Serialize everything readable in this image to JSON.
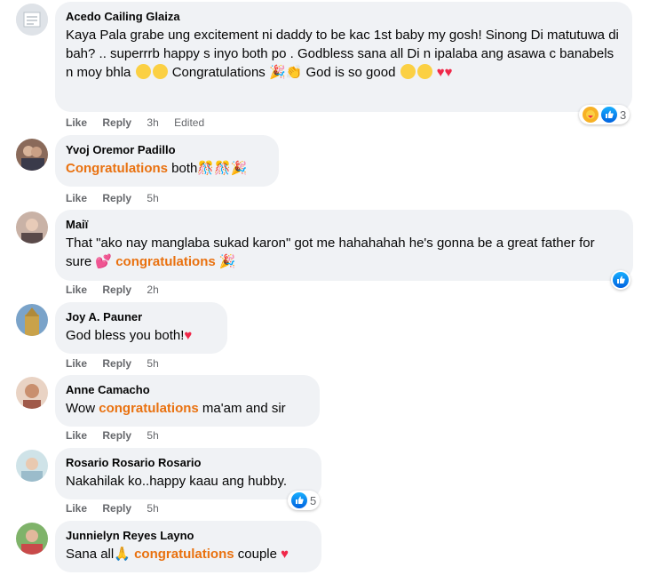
{
  "comments": [
    {
      "author": "Acedo Cailing Glaiza",
      "text": "Kaya Pala grabe ung excitement ni daddy to be kac 1st baby my gosh! Sinong Di matutuwa di bah? .. superrrb happy s inyo both po . Godbless sana all Di n ipalaba ang asawa c banabels n moy bhla",
      "text_congrats": "Congratulations",
      "text_end": "God is so good",
      "like": "Like",
      "reply": "Reply",
      "time": "3h",
      "edited": "Edited",
      "reaction_count": "3",
      "reaction_icons": [
        "care-icon",
        "like-icon"
      ]
    },
    {
      "author": "Yvoj Oremor Padillo",
      "highlight": "Congratulations",
      "text": "both",
      "like": "Like",
      "reply": "Reply",
      "time": "5h"
    },
    {
      "author": "Maiï",
      "text": "That \"ako nay manglaba sukad karon\" got me hahahahah he's gonna be a great father for sure",
      "highlight": "congratulations",
      "like": "Like",
      "reply": "Reply",
      "time": "2h",
      "reaction_icons": [
        "like-icon"
      ]
    },
    {
      "author": "Joy A. Pauner",
      "text": "God bless you both!",
      "like": "Like",
      "reply": "Reply",
      "time": "5h"
    },
    {
      "author": "Anne Camacho",
      "text_before": "Wow",
      "highlight": "congratulations",
      "text_after": "ma'am and sir",
      "like": "Like",
      "reply": "Reply",
      "time": "5h"
    },
    {
      "author": "Rosario Rosario Rosario",
      "text": "Nakahilak ko..happy kaau ang hubby.",
      "like": "Like",
      "reply": "Reply",
      "time": "5h",
      "reaction_count": "5",
      "reaction_icons": [
        "like-icon"
      ]
    },
    {
      "author": "Junnielyn Reyes Layno",
      "text_before": "Sana all",
      "highlight": "congratulations",
      "text_after": "couple"
    }
  ],
  "colors": {
    "bubble": "#f0f2f5",
    "highlight": "#e9710f",
    "meta": "#65676b",
    "like_blue": "#0866ff",
    "heart_red": "#f02849"
  }
}
